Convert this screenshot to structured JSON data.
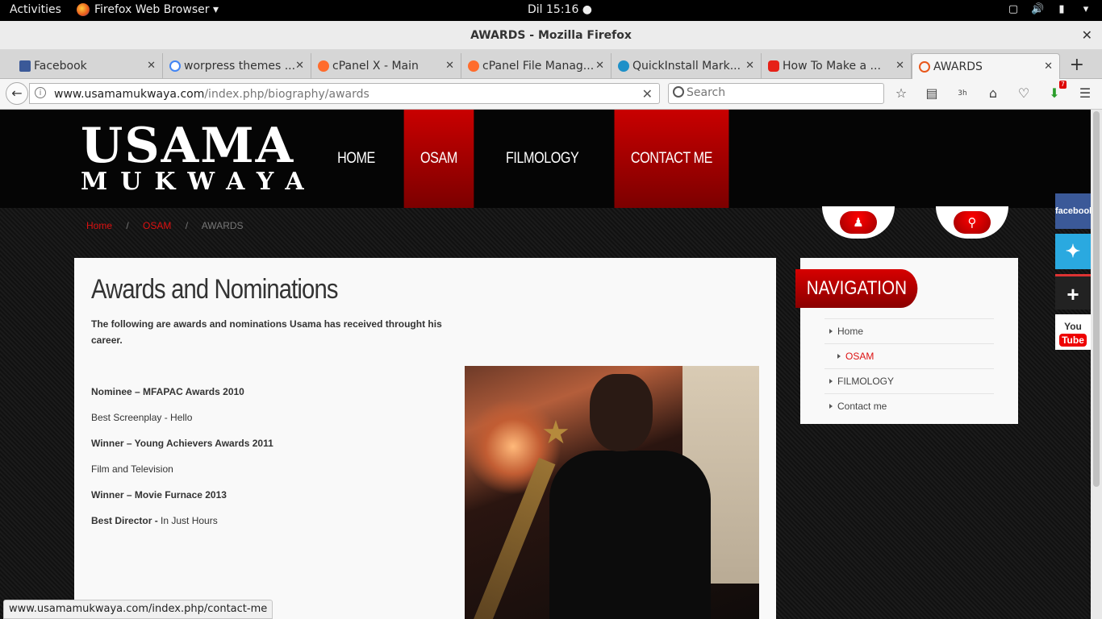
{
  "system": {
    "activities": "Activities",
    "app_menu": "Firefox Web Browser ▾",
    "clock": "Dil 15:16"
  },
  "window": {
    "title": "AWARDS - Mozilla Firefox"
  },
  "tabs": [
    {
      "label": "Facebook",
      "favicon_color": "#3b5998"
    },
    {
      "label": "worpress themes ...",
      "favicon_color": "#4285f4"
    },
    {
      "label": "cPanel X - Main",
      "favicon_color": "#ff6c2c"
    },
    {
      "label": "cPanel File Manag...",
      "favicon_color": "#ff6c2c"
    },
    {
      "label": "QuickInstall Mark...",
      "favicon_color": "#1e90c8"
    },
    {
      "label": "How To Make a ...",
      "favicon_color": "#e62117"
    },
    {
      "label": "AWARDS",
      "favicon_color": "#e8571b",
      "active": true
    }
  ],
  "navbar": {
    "url_domain": "www.usamamukwaya.com",
    "url_path": "/index.php/biography/awards",
    "search_placeholder": "Search",
    "download_badge": "7",
    "toolbar_counter": "3h"
  },
  "site": {
    "logo_line1": "USAMA",
    "logo_line2": "MUKWAYA",
    "menu": [
      "HOME",
      "OSAM",
      "FILMOLOGY",
      "CONTACT ME"
    ],
    "breadcrumb": {
      "home": "Home",
      "section": "OSAM",
      "current": "AWARDS",
      "separator": "/"
    },
    "heading": "Awards and Nominations",
    "intro": "The following are awards and nominations Usama has received throught his career.",
    "awards": [
      {
        "text": "Nominee – MFAPAC Awards 2010",
        "bold": true
      },
      {
        "text": "Best Screenplay - Hello",
        "bold": false
      },
      {
        "text": "Winner – Young Achievers Awards 2011",
        "bold": true
      },
      {
        "text": "Film and Television",
        "bold": false
      },
      {
        "text": "Winner – Movie Furnace 2013",
        "bold": true
      }
    ],
    "best_director_label": "Best Director -",
    "best_director_value": " In Just Hours",
    "sidebar": {
      "title": "NAVIGATION",
      "items": [
        "Home",
        "OSAM",
        "FILMOLOGY",
        "Contact me"
      ]
    },
    "social": {
      "facebook": "facebook",
      "youtube_top": "You",
      "youtube_bottom": "Tube"
    }
  },
  "statusbar": "www.usamamukwaya.com/index.php/contact-me",
  "colors": {
    "accent_red": "#c90000",
    "link_red": "#dd1111"
  }
}
